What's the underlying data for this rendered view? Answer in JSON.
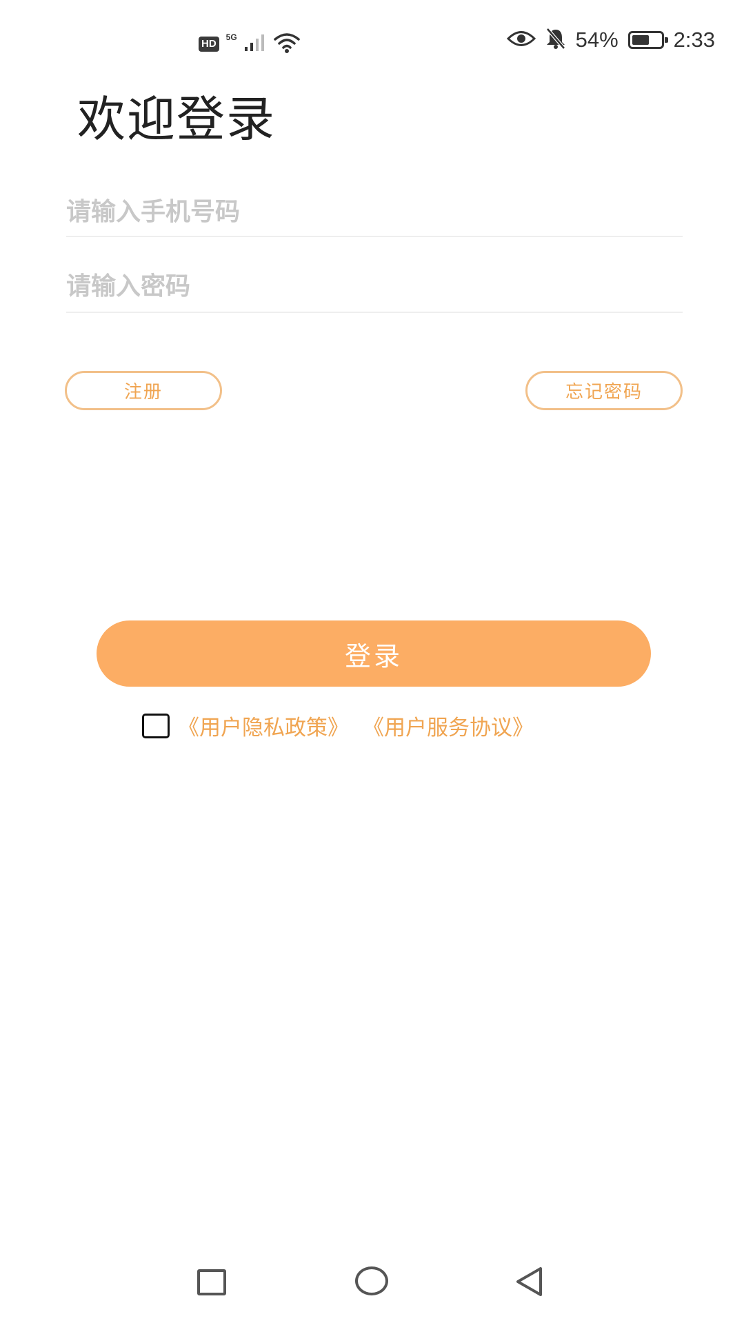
{
  "status_bar": {
    "hd_label": "HD",
    "network_label": "5G",
    "battery_percent": "54%",
    "time": "2:33",
    "icons": [
      "signal-icon",
      "wifi-icon",
      "eye-icon",
      "bell-off-icon",
      "battery-icon"
    ]
  },
  "page": {
    "title": "欢迎登录"
  },
  "form": {
    "phone_placeholder": "请输入手机号码",
    "password_placeholder": "请输入密码",
    "register_label": "注册",
    "forgot_label": "忘记密码",
    "login_label": "登录"
  },
  "agreement": {
    "checked": false,
    "privacy_link": "《用户隐私政策》",
    "service_link": "《用户服务协议》"
  },
  "nav_bar": {
    "icons": [
      "recent-apps-icon",
      "home-icon",
      "back-icon"
    ]
  },
  "colors": {
    "accent": "#fcad64",
    "accent_text": "#f0a552",
    "accent_border": "#f2c089",
    "placeholder": "#c8c8c8"
  }
}
